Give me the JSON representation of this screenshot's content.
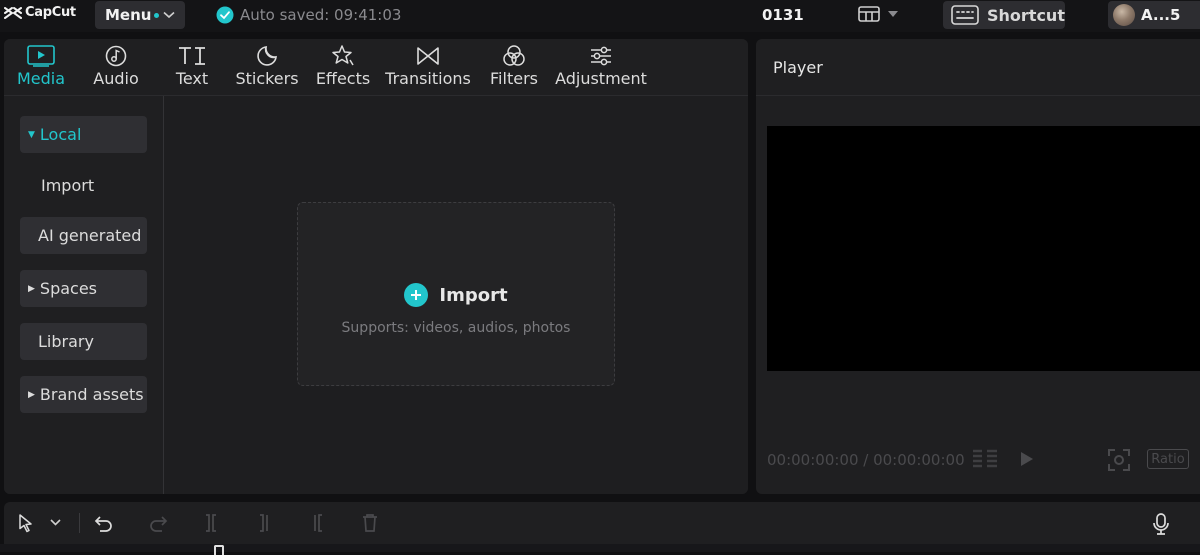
{
  "app": {
    "logo_text": "CapCut",
    "menu_label": "Menu",
    "autosave_text": "Auto saved: 09:41:03",
    "project_name": "0131",
    "shortcut_label": "Shortcut",
    "account_label": "A...5"
  },
  "tabs": [
    {
      "label": "Media",
      "icon": "media-icon",
      "active": true
    },
    {
      "label": "Audio",
      "icon": "audio-icon"
    },
    {
      "label": "Text",
      "icon": "text-icon"
    },
    {
      "label": "Stickers",
      "icon": "stickers-icon"
    },
    {
      "label": "Effects",
      "icon": "effects-icon"
    },
    {
      "label": "Transitions",
      "icon": "transitions-icon"
    },
    {
      "label": "Filters",
      "icon": "filters-icon"
    },
    {
      "label": "Adjustment",
      "icon": "adjustment-icon"
    }
  ],
  "sidebar": {
    "items": [
      {
        "label": "Local",
        "expanded": true,
        "active": true
      },
      {
        "label": "Import"
      },
      {
        "label": "AI generated"
      },
      {
        "label": "Spaces",
        "collapsed": true
      },
      {
        "label": "Library"
      },
      {
        "label": "Brand assets",
        "collapsed": true
      }
    ]
  },
  "import_area": {
    "title": "Import",
    "subtitle": "Supports: videos, audios, photos"
  },
  "player": {
    "title": "Player",
    "timecode": "00:00:00:00 / 00:00:00:00",
    "ratio_label": "Ratio"
  },
  "colors": {
    "accent": "#22c6cc",
    "background": "#101012",
    "panel": "#1f1f21"
  }
}
